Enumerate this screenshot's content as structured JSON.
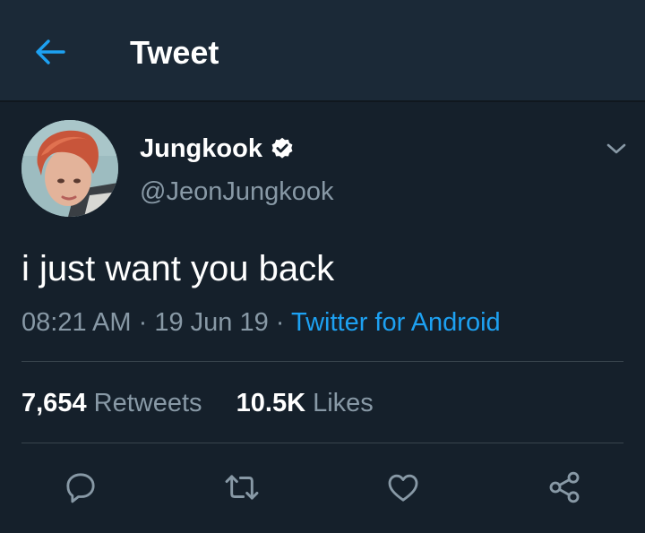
{
  "header": {
    "back_icon": "arrow-left-icon",
    "title": "Tweet"
  },
  "tweet": {
    "display_name": "Jungkook",
    "verified_icon": "verified-badge-icon",
    "handle": "@JeonJungkook",
    "text": "i just want you back",
    "time": "08:21 AM",
    "separator": " · ",
    "date": "19 Jun 19",
    "source": "Twitter for Android"
  },
  "stats": {
    "retweets_count": "7,654",
    "retweets_label": "Retweets",
    "likes_count": "10.5K",
    "likes_label": "Likes"
  },
  "actions": [
    "reply-icon",
    "retweet-icon",
    "like-icon",
    "share-icon"
  ],
  "colors": {
    "background": "#15202b",
    "header": "#1b2937",
    "accent": "#1da1f2",
    "secondary_text": "#8899a6",
    "divider": "#38444d"
  }
}
